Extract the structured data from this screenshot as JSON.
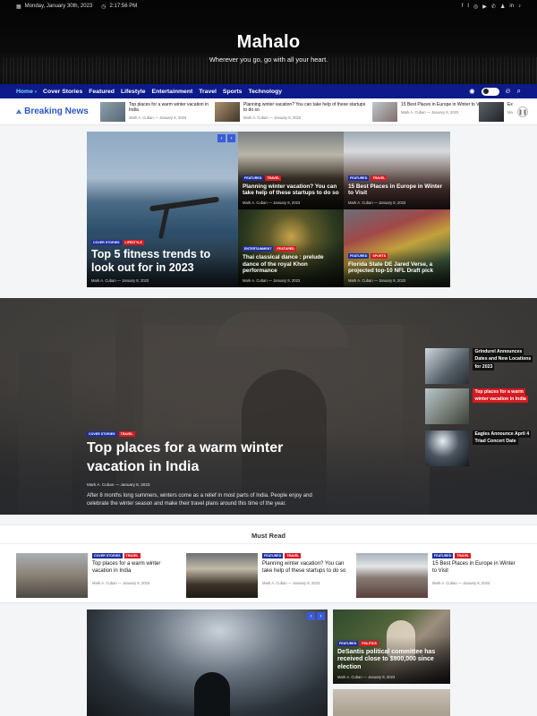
{
  "topbar": {
    "date": "Monday, January 30th, 2023",
    "time": "2:17:56 PM",
    "socials": [
      "f",
      "t",
      "◎",
      "▶",
      "✆",
      "♟",
      "in",
      "♪"
    ]
  },
  "site": {
    "title": "Mahalo",
    "tagline": "Wherever you go, go with all your heart."
  },
  "nav": {
    "items": [
      "Home",
      "Cover Stories",
      "Featured",
      "Lifestyle",
      "Entertainment",
      "Travel",
      "Sports",
      "Technology"
    ]
  },
  "breaking": {
    "label": "Breaking News",
    "items": [
      {
        "title": "Top places for a warm winter vacation in India",
        "meta": "Mark A. Cuban — January 8, 2023",
        "color": "#6d7f8c"
      },
      {
        "title": "Planning winter vacation? You can take help of these startups to do so",
        "meta": "Mark A. Cuban — January 8, 2023",
        "color": "#5a4b3c"
      },
      {
        "title": "15 Best Places in Europe in Winter to Visit",
        "meta": "Mark A. Cuban — January 8, 2023",
        "color": "#8a8f96"
      },
      {
        "title": "Ex",
        "meta": "Ma",
        "color": "#3c4046"
      }
    ]
  },
  "grid": {
    "main": {
      "tags": [
        "Cover Stories",
        "Lifestyle"
      ],
      "title": "Top 5 fitness trends to look out for in 2023",
      "meta": "Mark A. Cuban — January 8, 2023"
    },
    "cards": [
      {
        "tags": [
          "Featured",
          "Travel"
        ],
        "title": "Planning winter vacation? You can take help of these startups to do so",
        "meta": "Mark A. Cuban — January 8, 2023"
      },
      {
        "tags": [
          "Featured",
          "Travel"
        ],
        "title": "15 Best Places in Europe in Winter to Visit",
        "meta": "Mark A. Cuban — January 8, 2023"
      },
      {
        "tags": [
          "Entertainment",
          "Featured"
        ],
        "title": "Thai classical dance : prelude dance of the royal Khon performance",
        "meta": "Mark A. Cuban — January 8, 2023"
      },
      {
        "tags": [
          "Featured",
          "Sports"
        ],
        "title": "Florida State DE Jared Verse, a projected top-10 NFL Draft pick",
        "meta": "Mark A. Cuban — January 8, 2023"
      }
    ]
  },
  "feature": {
    "tags": [
      "Cover Stories",
      "Travel"
    ],
    "title": "Top places for a warm winter vacation in India",
    "meta": "Mark A. Cuban — January 8, 2023",
    "excerpt": "After 8 months long summers, winters come as a relief in most parts of India. People enjoy and celebrate the winter season and make their travel plans around this time of the year.",
    "side": [
      {
        "title": "Grindurel Announces Dates and New Locations for 2023"
      },
      {
        "title": "Top places for a warm winter vacation in India"
      },
      {
        "title": "Eagles Announce April 4 Triad Concert Date"
      }
    ]
  },
  "must_read": {
    "heading": "Must Read",
    "items": [
      {
        "tags": [
          "Cover Stories",
          "Travel"
        ],
        "title": "Top places for a warm winter vacation in India",
        "meta": "Mark A. Cuban — January 8, 2023"
      },
      {
        "tags": [
          "Featured",
          "Travel"
        ],
        "title": "Planning winter vacation? You can take help of these startups to do so",
        "meta": "Mark A. Cuban — January 8, 2023"
      },
      {
        "tags": [
          "Featured",
          "Travel"
        ],
        "title": "15 Best Places in Europe in Winter to Visit",
        "meta": "Mark A. Cuban — January 8, 2023"
      }
    ]
  },
  "bottom": {
    "side": {
      "tags": [
        "Featured",
        "Politics"
      ],
      "title": "DeSantis political committee has received close to $900,000 since election",
      "meta": "Mark A. Cuban — January 8, 2023"
    }
  }
}
